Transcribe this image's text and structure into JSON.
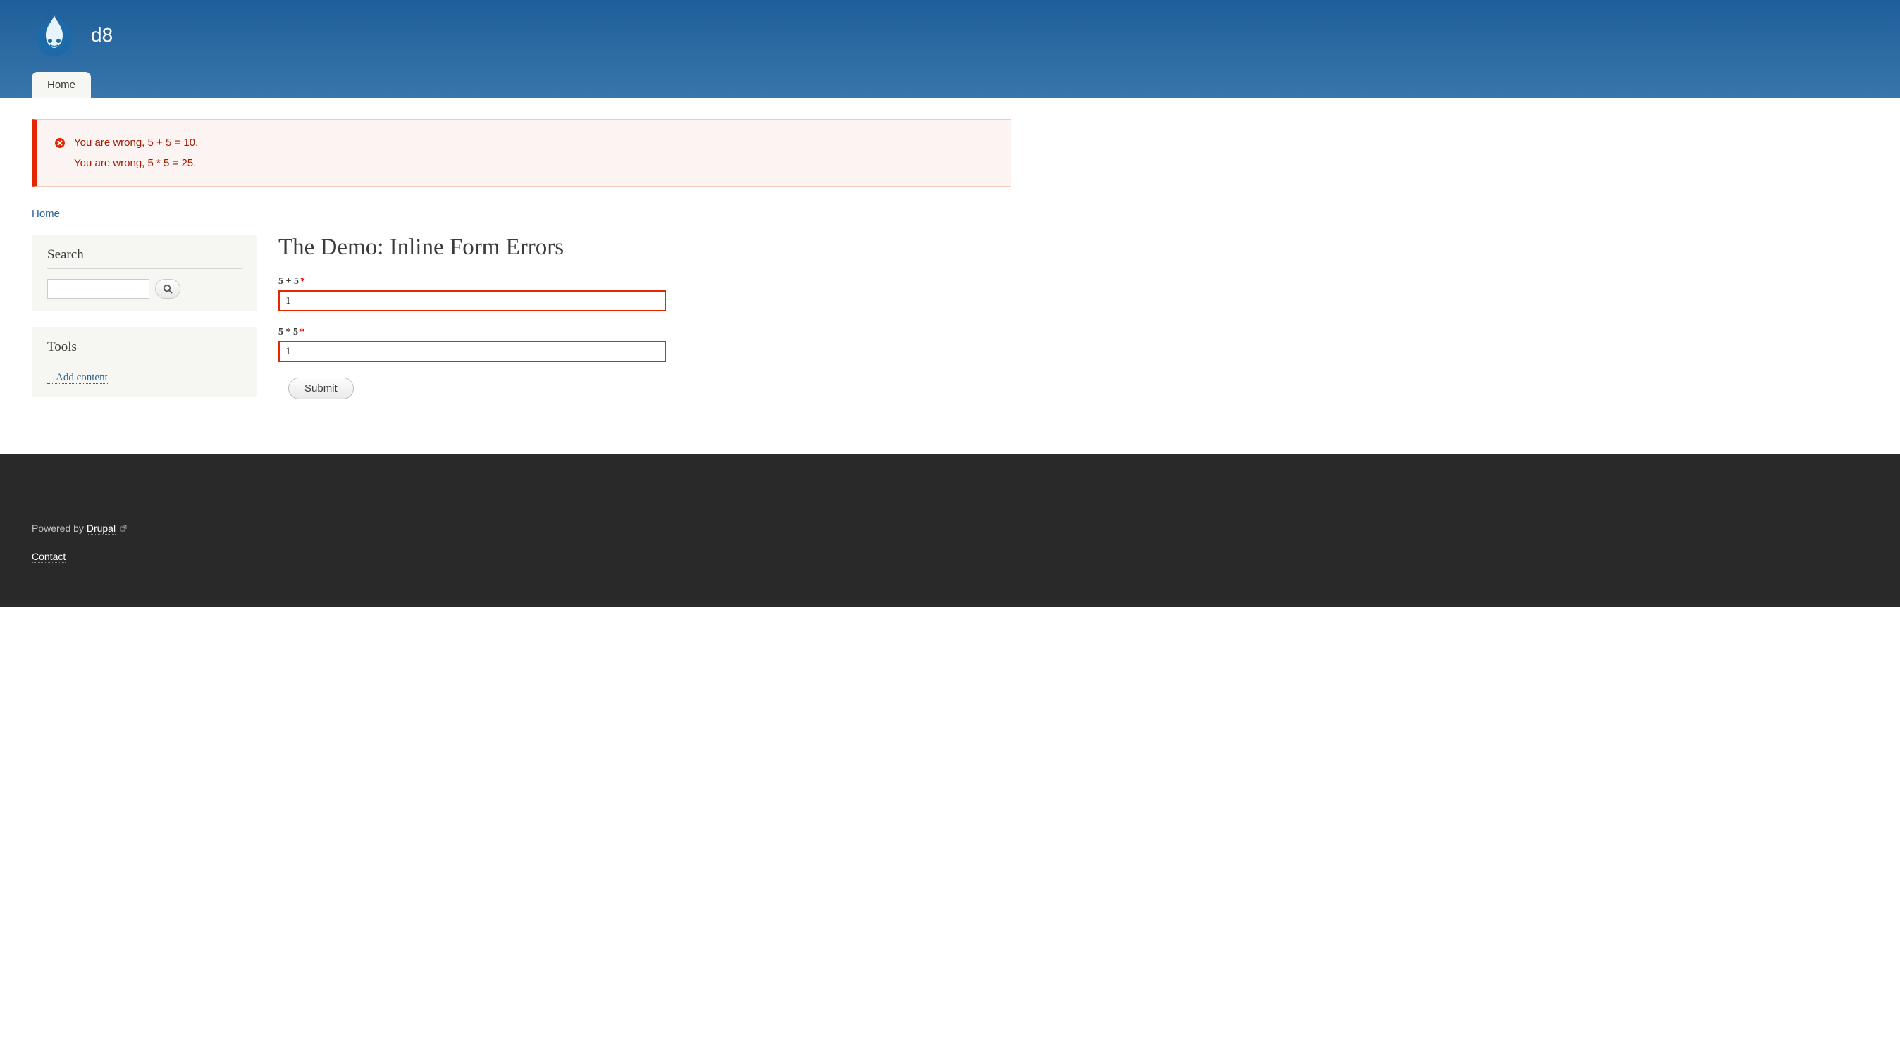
{
  "header": {
    "site_name": "d8",
    "nav": [
      {
        "label": "Home"
      }
    ]
  },
  "messages": {
    "errors": [
      "You are wrong, 5 + 5 = 10.",
      "You are wrong, 5 * 5 = 25."
    ]
  },
  "breadcrumb": {
    "items": [
      {
        "label": "Home"
      }
    ]
  },
  "sidebar": {
    "search": {
      "title": "Search",
      "value": ""
    },
    "tools": {
      "title": "Tools",
      "links": [
        {
          "label": "Add content"
        }
      ]
    }
  },
  "page": {
    "title": "The Demo: Inline Form Errors",
    "form": {
      "fields": [
        {
          "label": "5 + 5",
          "required": true,
          "value": "1"
        },
        {
          "label": "5 * 5",
          "required": true,
          "value": "1"
        }
      ],
      "submit_label": "Submit"
    }
  },
  "footer": {
    "powered_prefix": "Powered by ",
    "powered_link": "Drupal",
    "contact": "Contact"
  }
}
